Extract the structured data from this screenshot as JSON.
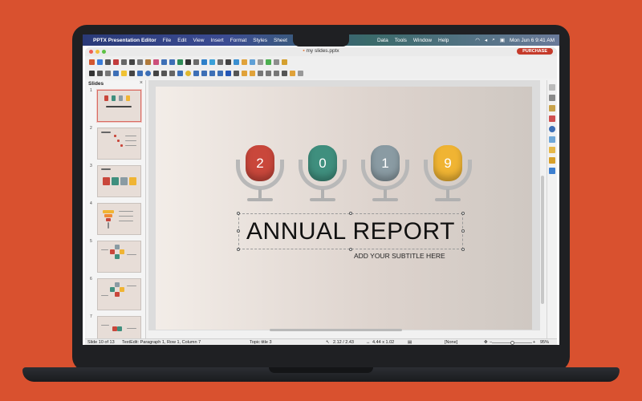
{
  "menubar": {
    "apple": "",
    "app_name": "PPTX Presentation Editor",
    "items": [
      "File",
      "Edit",
      "View",
      "Insert",
      "Format",
      "Styles",
      "Sheet",
      "Data",
      "Tools",
      "Window",
      "Help"
    ],
    "date_time": "Mon Jun 6  9:41 AM"
  },
  "window": {
    "title": "my slides.pptx",
    "purchase_label": "PURCHASE"
  },
  "slides_panel": {
    "title": "Slides",
    "close_glyph": "×",
    "thumbnails": [
      {
        "number": "1"
      },
      {
        "number": "2"
      },
      {
        "number": "3"
      },
      {
        "number": "4"
      },
      {
        "number": "5"
      },
      {
        "number": "6"
      },
      {
        "number": "7"
      }
    ]
  },
  "slide": {
    "mic_numbers": [
      {
        "text": "2",
        "color": "#c9473b"
      },
      {
        "text": "0",
        "color": "#3f8f7e"
      },
      {
        "text": "1",
        "color": "#8a9ba3"
      },
      {
        "text": "9",
        "color": "#f0b433"
      }
    ],
    "title": "ANNUAL REPORT",
    "subtitle": "ADD YOUR SUBTITLE HERE"
  },
  "statusbar": {
    "slide_info": "Slide 10 of 13",
    "text_edit": "TextEdit: Paragraph 1, Row 1, Column 7",
    "layout": "Topic title 3",
    "position": "2.12 / 2.43",
    "size": "4.44 x 1.02",
    "language": "[None]",
    "zoom": "95%"
  },
  "colors": {
    "background": "#d9512f",
    "purchase": "#c53a2a"
  }
}
